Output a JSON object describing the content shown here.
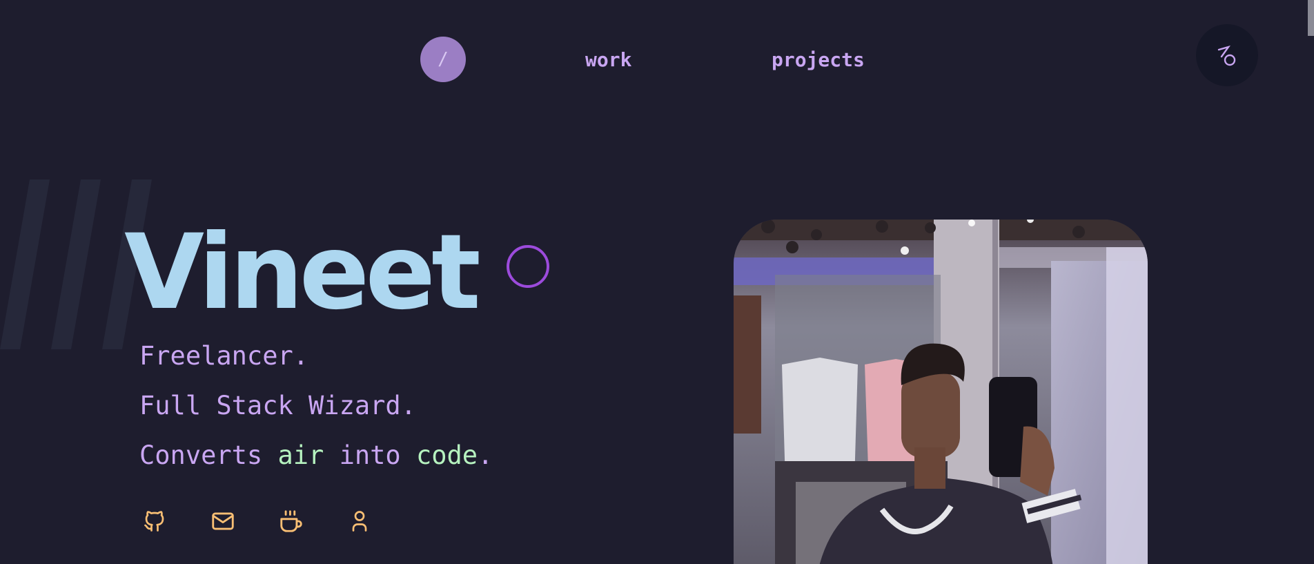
{
  "nav": {
    "home_label": "/",
    "links": [
      "work",
      "projects"
    ]
  },
  "hero": {
    "name": "Vineet",
    "taglines": [
      "Freelancer.",
      "Full Stack Wizard."
    ],
    "tagline3": {
      "prefix": "Converts ",
      "highlight1": "air",
      "middle": " into ",
      "highlight2": "code",
      "suffix": "."
    }
  },
  "socials": [
    {
      "icon": "github-icon"
    },
    {
      "icon": "mail-icon"
    },
    {
      "icon": "coffee-icon"
    },
    {
      "icon": "user-icon"
    }
  ],
  "colors": {
    "background": "#1e1d2e",
    "name": "#add7f0",
    "tagline": "#c9a6f2",
    "highlight": "#b6f2bf",
    "icon": "#f9bf74",
    "accent": "#9c4bdc"
  }
}
